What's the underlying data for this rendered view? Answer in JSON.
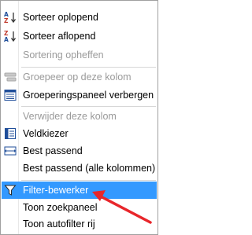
{
  "menu": {
    "items": [
      {
        "label": "Sorteer oplopend",
        "icon": "sort-ascending-icon",
        "enabled": true
      },
      {
        "label": "Sorteer aflopend",
        "icon": "sort-descending-icon",
        "enabled": true
      },
      {
        "label": "Sortering opheffen",
        "icon": "",
        "enabled": false
      },
      {
        "label": "Groepeer op deze kolom",
        "icon": "group-by-column-icon",
        "enabled": false
      },
      {
        "label": "Groeperingspaneel verbergen",
        "icon": "group-panel-icon",
        "enabled": true
      },
      {
        "label": "Verwijder deze kolom",
        "icon": "",
        "enabled": false
      },
      {
        "label": "Veldkiezer",
        "icon": "field-chooser-icon",
        "enabled": true
      },
      {
        "label": "Best passend",
        "icon": "best-fit-icon",
        "enabled": true
      },
      {
        "label": "Best passend (alle kolommen)",
        "icon": "",
        "enabled": true
      },
      {
        "label": "Filter-bewerker",
        "icon": "filter-funnel-icon",
        "enabled": true,
        "selected": true
      },
      {
        "label": "Toon zoekpaneel",
        "icon": "",
        "enabled": true
      },
      {
        "label": "Toon autofilter rij",
        "icon": "",
        "enabled": true
      }
    ]
  },
  "colors": {
    "selection": "#3399ff",
    "disabled_text": "#9a9a9a",
    "annotation_arrow": "#e8262b"
  }
}
